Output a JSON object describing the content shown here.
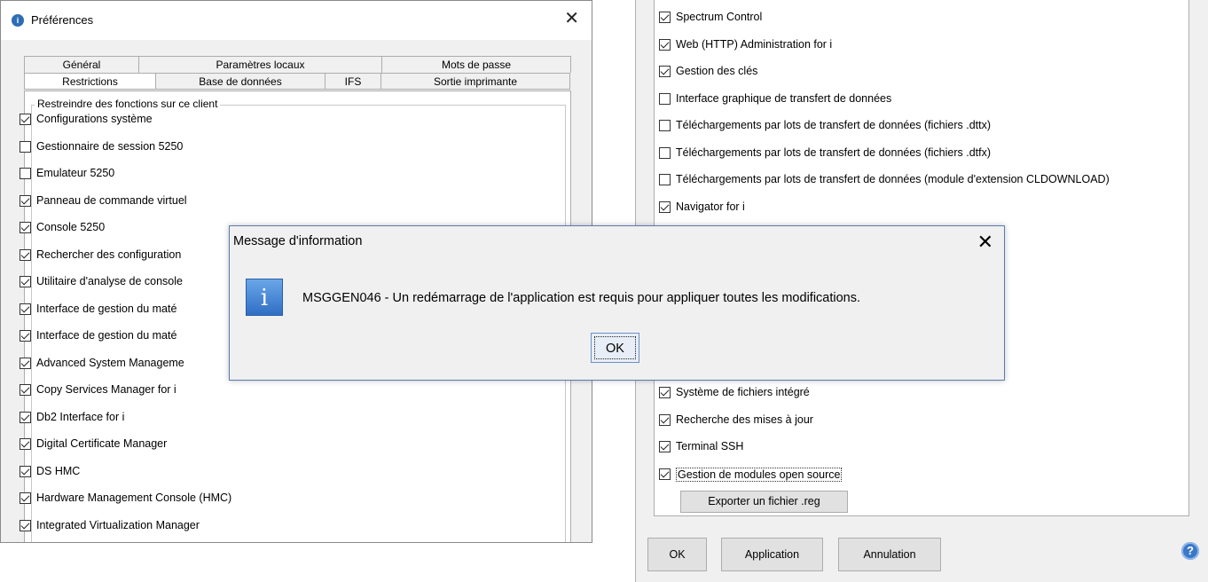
{
  "left_window": {
    "title": "Préférences",
    "tabs_back": [
      "Général",
      "Paramètres locaux",
      "Mots de passe"
    ],
    "tabs_front": [
      "Restrictions",
      "Base de données",
      "IFS",
      "Sortie imprimante"
    ],
    "group_title": "Restreindre des fonctions sur ce client",
    "items": [
      {
        "label": "Configurations système",
        "checked": true
      },
      {
        "label": "Gestionnaire de session 5250",
        "checked": false
      },
      {
        "label": "Emulateur 5250",
        "checked": false
      },
      {
        "label": "Panneau de commande virtuel",
        "checked": true
      },
      {
        "label": "Console 5250",
        "checked": true
      },
      {
        "label": "Rechercher des configuration",
        "checked": true
      },
      {
        "label": "Utilitaire d'analyse de console",
        "checked": true
      },
      {
        "label": "Interface de gestion du maté",
        "checked": true
      },
      {
        "label": "Interface de gestion du maté",
        "checked": true
      },
      {
        "label": "Advanced System Manageme",
        "checked": true
      },
      {
        "label": "Copy Services Manager for i",
        "checked": true
      },
      {
        "label": "Db2 Interface for i",
        "checked": true
      },
      {
        "label": "Digital Certificate Manager",
        "checked": true
      },
      {
        "label": "DS HMC",
        "checked": true
      },
      {
        "label": "Hardware Management Console (HMC)",
        "checked": true
      },
      {
        "label": "Integrated Virtualization Manager",
        "checked": true
      }
    ]
  },
  "right_window": {
    "items_top": [
      {
        "label": "Spectrum Control",
        "checked": true
      },
      {
        "label": "Web (HTTP) Administration for i",
        "checked": true
      },
      {
        "label": "Gestion des clés",
        "checked": true
      },
      {
        "label": "Interface graphique de transfert de données",
        "checked": false
      },
      {
        "label": "Téléchargements par lots de transfert de données (fichiers .dttx)",
        "checked": false
      },
      {
        "label": "Téléchargements par lots de transfert de données (fichiers .dtfx)",
        "checked": false
      },
      {
        "label": "Téléchargements par lots de transfert de données (module d'extension CLDOWNLOAD)",
        "checked": false
      },
      {
        "label": "Navigator for i",
        "checked": true
      }
    ],
    "items_bottom": [
      {
        "label": "Système de fichiers intégré",
        "checked": true
      },
      {
        "label": "Recherche des mises à jour",
        "checked": true
      },
      {
        "label": "Terminal SSH",
        "checked": true
      },
      {
        "label": "Gestion de modules open source",
        "checked": true
      }
    ],
    "export_label": "Exporter un fichier .reg",
    "ok_label": "OK",
    "apply_label": "Application",
    "cancel_label": "Annulation"
  },
  "dialog": {
    "title": "Message d'information",
    "message": "MSGGEN046 - Un redémarrage de l'application est requis pour appliquer toutes les modifications.",
    "ok_label": "OK"
  }
}
